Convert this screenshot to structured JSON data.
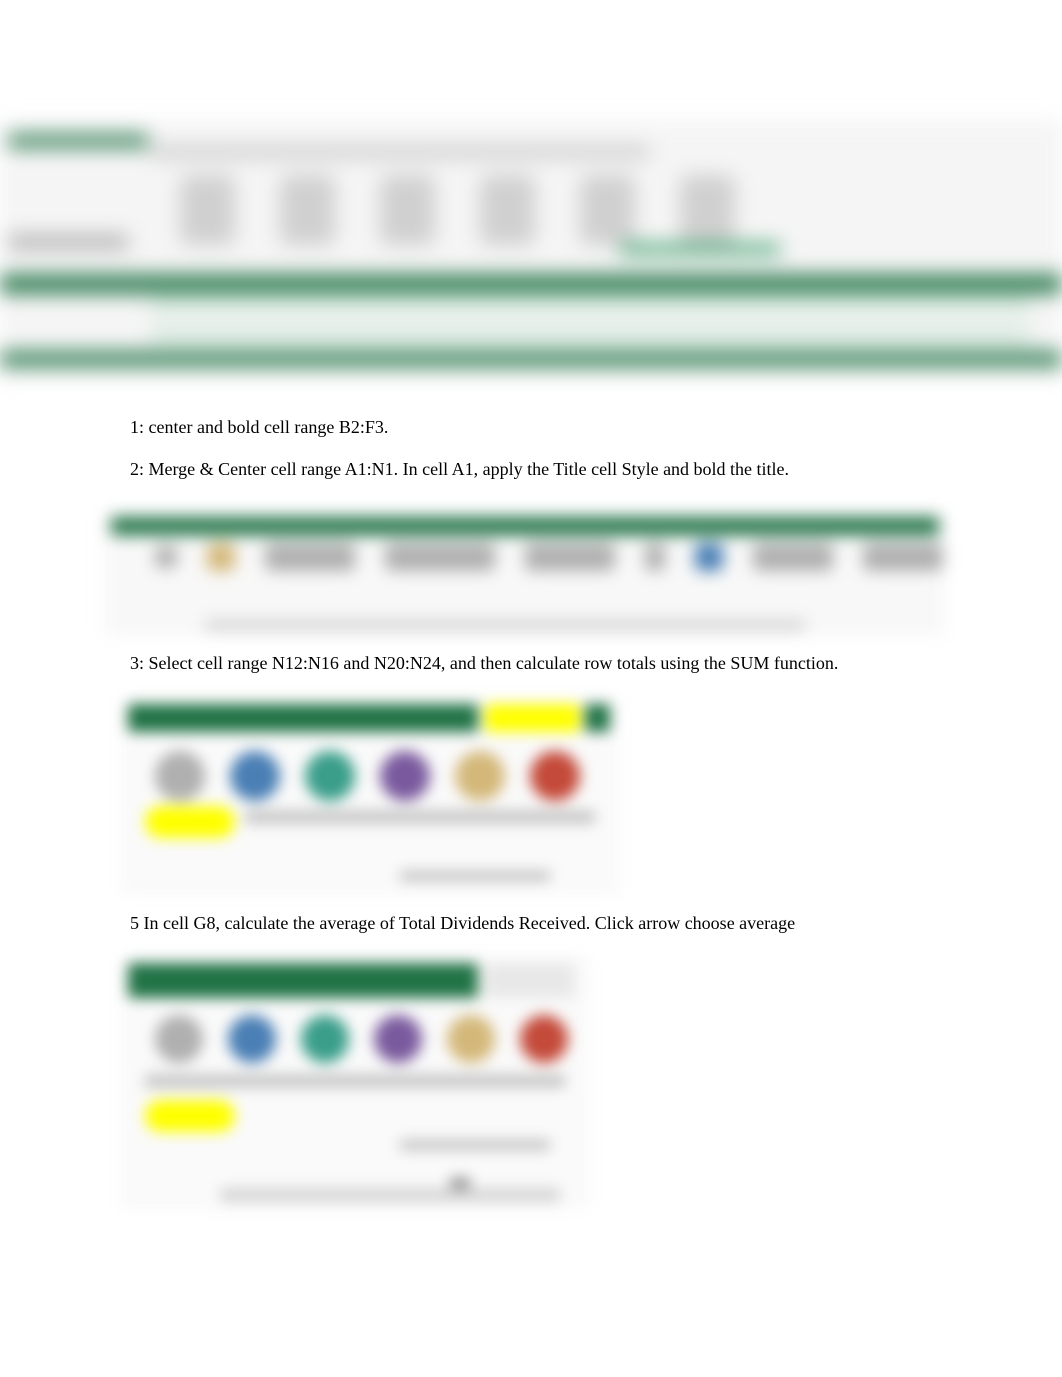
{
  "instructions": {
    "step1": "1: center and bold cell range B2:F3.",
    "step2": "2: Merge & Center cell range A1:N1. In cell A1, apply the Title cell Style and bold the title.",
    "step3": "3: Select cell range N12:N16 and N20:N24, and then calculate row totals using the SUM function.",
    "step5": "5 In cell G8, calculate the average of Total Dividends Received. Click arrow choose average"
  }
}
